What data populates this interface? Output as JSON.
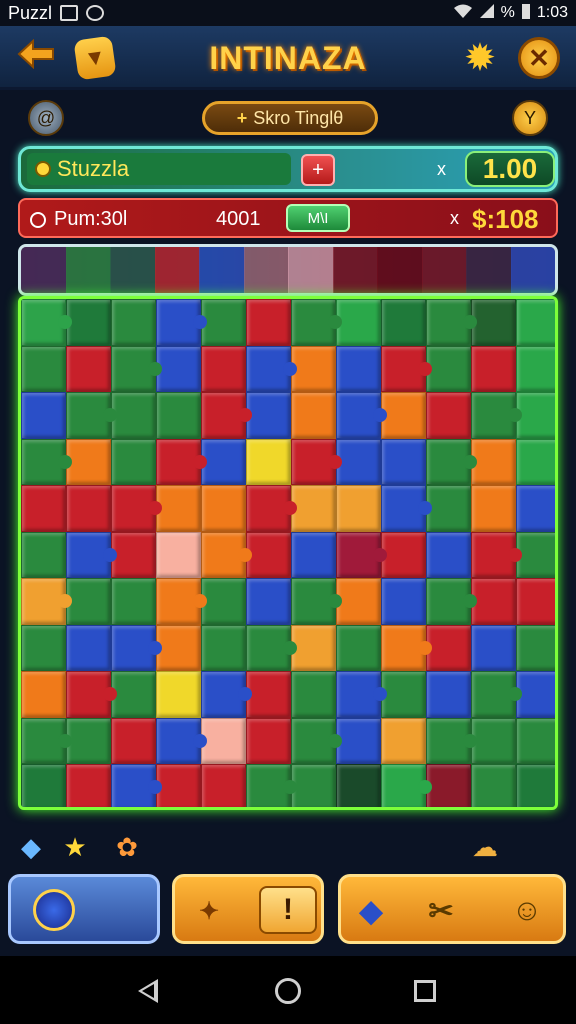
{
  "status_bar": {
    "app_name": "Puzzl",
    "battery_label": "%",
    "time": "1:03"
  },
  "header": {
    "title": "INTINAZA",
    "back_icon": "arrow-left-icon",
    "badge_icon": "badge-icon",
    "settings_icon": "gear-icon",
    "close_icon": "close-icon"
  },
  "toolbar": {
    "pill_text": "Skro Tinglθ",
    "pill_prefix": "+"
  },
  "score_bar": {
    "label": "Stuzzla",
    "plus_label": "+",
    "multiplier": "x",
    "value": "1.00",
    "colors": {
      "border": "#6fe8d6",
      "value": "#ffe34a"
    }
  },
  "timer_bar": {
    "label": "Pum:30l",
    "count": "4001",
    "button_label": "M\\I",
    "multiplier": "x",
    "amount": "$:108"
  },
  "board": {
    "border_color": "#7dff3a",
    "rows": [
      [
        "#2da34a",
        "#1f7a3a",
        "#2a8a3e",
        "#2a4fc8",
        "#2a8a3e",
        "#c8202a",
        "#2a8a3e",
        "#2aa84a",
        "#1f7a3a",
        "#2a8a3e",
        "#23622f",
        "#2aa84a"
      ],
      [
        "#2a8a3e",
        "#c8202a",
        "#2a8a3e",
        "#2a4fc8",
        "#c8202a",
        "#2a4fc8",
        "#f07a1a",
        "#2a4fc8",
        "#c8202a",
        "#2a8a3e",
        "#c8202a",
        "#2aa84a"
      ],
      [
        "#2a4fc8",
        "#2a8a3e",
        "#2a8a3e",
        "#2a8a3e",
        "#c8202a",
        "#2a4fc8",
        "#f07a1a",
        "#2a4fc8",
        "#f07a1a",
        "#c8202a",
        "#2a8a3e",
        "#2aa84a"
      ],
      [
        "#2a8a3e",
        "#f07a1a",
        "#2a8a3e",
        "#c8202a",
        "#2a4fc8",
        "#f0d82a",
        "#c8202a",
        "#2a4fc8",
        "#2a4fc8",
        "#2a8a3e",
        "#f07a1a",
        "#2aa84a"
      ],
      [
        "#c8202a",
        "#c8202a",
        "#c8202a",
        "#f07a1a",
        "#f07a1a",
        "#c8202a",
        "#f0a030",
        "#f0a030",
        "#2a4fc8",
        "#2a8a3e",
        "#f07a1a",
        "#2a4fc8"
      ],
      [
        "#2a8a3e",
        "#2a4fc8",
        "#c8202a",
        "#f8b0a0",
        "#f07a1a",
        "#c8202a",
        "#2a4fc8",
        "#a01a3a",
        "#c8202a",
        "#2a4fc8",
        "#c8202a",
        "#2a8a3e"
      ],
      [
        "#f0a030",
        "#2a8a3e",
        "#2a8a3e",
        "#f07a1a",
        "#2a8a3e",
        "#2a4fc8",
        "#2a8a3e",
        "#f07a1a",
        "#2a4fc8",
        "#2a8a3e",
        "#c8202a",
        "#c8202a"
      ],
      [
        "#2a8a3e",
        "#2a4fc8",
        "#2a4fc8",
        "#f07a1a",
        "#2a8a3e",
        "#2a8a3e",
        "#f0a030",
        "#2a8a3e",
        "#f07a1a",
        "#c8202a",
        "#2a4fc8",
        "#2a8a3e"
      ],
      [
        "#f07a1a",
        "#c8202a",
        "#2a8a3e",
        "#f0d82a",
        "#2a4fc8",
        "#c8202a",
        "#2a8a3e",
        "#2a4fc8",
        "#2a8a3e",
        "#2a4fc8",
        "#2a8a3e",
        "#2a4fc8"
      ],
      [
        "#2a8a3e",
        "#2a8a3e",
        "#c8202a",
        "#2a4fc8",
        "#f8b0a0",
        "#c8202a",
        "#2a8a3e",
        "#2a4fc8",
        "#f0a030",
        "#2a8a3e",
        "#2a8a3e",
        "#2a8a3e"
      ],
      [
        "#1f7a3a",
        "#c8202a",
        "#2a4fc8",
        "#c8202a",
        "#c8202a",
        "#2a8a3e",
        "#2a8a3e",
        "#1a4a2a",
        "#2aa84a",
        "#8a1a2a",
        "#2a8a3e",
        "#1f7a3a"
      ]
    ]
  },
  "tray": {
    "pieces": [
      {
        "color": "#4a2a5a"
      },
      {
        "color": "#2a8a3e"
      },
      {
        "color": "#2a5a4a"
      },
      {
        "color": "#c8202a"
      },
      {
        "color": "#2a4fc8"
      },
      {
        "color": "#a06a7a"
      },
      {
        "color": "#d8a0b0"
      },
      {
        "color": "#7a1a2a"
      },
      {
        "color": "#6a0a1a"
      },
      {
        "color": "#7a1a2a"
      },
      {
        "color": "#3a2a4a"
      },
      {
        "color": "#2a4fc8"
      }
    ]
  },
  "mini_icons": [
    "tag-icon",
    "star-icon",
    "gem-icon",
    "cloud-icon"
  ],
  "action_bar": {
    "blue_button_icon": "face-icon",
    "orange_button_icons": [
      "map-icon"
    ],
    "question_label": "!",
    "right_button_icons": [
      "diamond-icon",
      "scissors-icon",
      "smile-icon"
    ]
  }
}
